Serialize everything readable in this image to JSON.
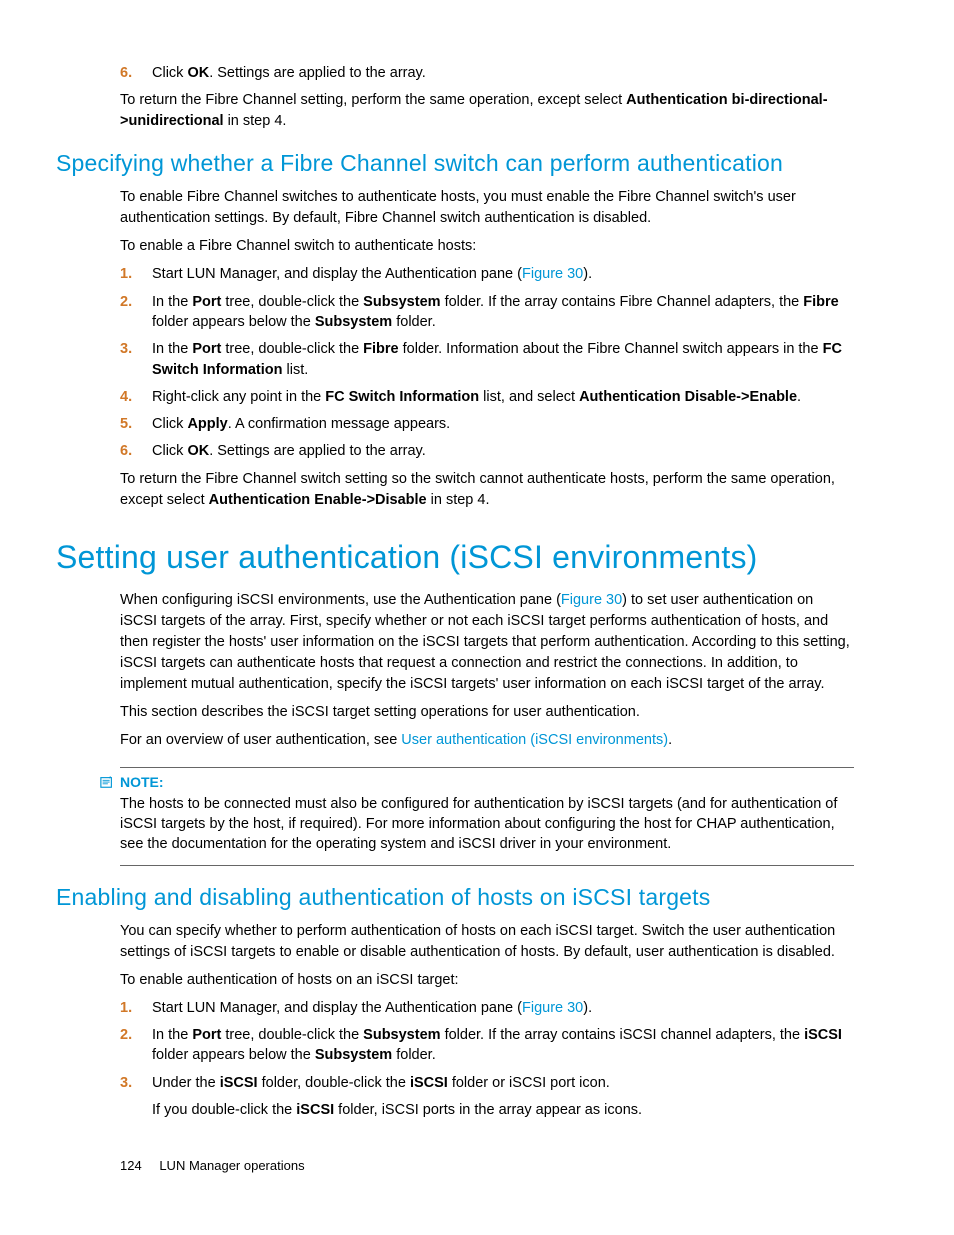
{
  "top_steps": [
    {
      "n": "6.",
      "parts": [
        [
          "Click "
        ],
        [
          "b",
          "OK"
        ],
        [
          ". Settings are applied to the array."
        ]
      ]
    }
  ],
  "top_after": {
    "parts": [
      [
        "To return the Fibre Channel setting, perform the same operation, except select "
      ],
      [
        "b",
        "Authentication bi-directional->unidirectional"
      ],
      [
        " in step 4."
      ]
    ]
  },
  "sec1_title": "Specifying whether a Fibre Channel switch can perform authentication",
  "sec1_intro": "To enable Fibre Channel switches to authenticate hosts, you must enable the Fibre Channel switch's user authentication settings. By default, Fibre Channel switch authentication is disabled.",
  "sec1_lead": "To enable a Fibre Channel switch to authenticate hosts:",
  "sec1_steps": [
    {
      "n": "1.",
      "parts": [
        [
          "Start LUN Manager, and display the Authentication pane ("
        ],
        [
          "l",
          "Figure 30"
        ],
        [
          ")."
        ]
      ]
    },
    {
      "n": "2.",
      "parts": [
        [
          "In the "
        ],
        [
          "b",
          "Port"
        ],
        [
          " tree, double-click the "
        ],
        [
          "b",
          "Subsystem"
        ],
        [
          " folder. If the array contains Fibre Channel adapters, the "
        ],
        [
          "b",
          "Fibre"
        ],
        [
          " folder appears below the "
        ],
        [
          "b",
          "Subsystem"
        ],
        [
          " folder."
        ]
      ]
    },
    {
      "n": "3.",
      "parts": [
        [
          "In the "
        ],
        [
          "b",
          "Port"
        ],
        [
          " tree, double-click the "
        ],
        [
          "b",
          "Fibre"
        ],
        [
          " folder. Information about the Fibre Channel switch appears in the "
        ],
        [
          "b",
          "FC Switch Information"
        ],
        [
          " list."
        ]
      ]
    },
    {
      "n": "4.",
      "parts": [
        [
          "Right-click any point in the "
        ],
        [
          "b",
          "FC Switch Information"
        ],
        [
          " list, and select "
        ],
        [
          "b",
          "Authentication Disable->Enable"
        ],
        [
          "."
        ]
      ]
    },
    {
      "n": "5.",
      "parts": [
        [
          "Click "
        ],
        [
          "b",
          "Apply"
        ],
        [
          ". A confirmation message appears."
        ]
      ]
    },
    {
      "n": "6.",
      "parts": [
        [
          "Click "
        ],
        [
          "b",
          "OK"
        ],
        [
          ". Settings are applied to the array."
        ]
      ]
    }
  ],
  "sec1_after": {
    "parts": [
      [
        "To return the Fibre Channel switch setting so the switch cannot authenticate hosts, perform the same operation, except select "
      ],
      [
        "b",
        "Authentication Enable->Disable"
      ],
      [
        " in step 4."
      ]
    ]
  },
  "big_title": "Setting user authentication (iSCSI environments)",
  "big_p1": {
    "parts": [
      [
        "When configuring iSCSI environments, use the Authentication pane ("
      ],
      [
        "l",
        "Figure 30"
      ],
      [
        ") to set user authentication on iSCSI targets of the array. First, specify whether or not each iSCSI target performs authentication of hosts, and then register the hosts' user information on the iSCSI targets that perform authentication. According to this setting, iSCSI targets can authenticate hosts that request a connection and restrict the connections. In addition, to implement mutual authentication, specify the iSCSI targets' user information on each iSCSI target of the array."
      ]
    ]
  },
  "big_p2": "This section describes the iSCSI target setting operations for user authentication.",
  "big_p3": {
    "parts": [
      [
        "For an overview of user authentication, see "
      ],
      [
        "l",
        "User authentication (iSCSI environments)"
      ],
      [
        "."
      ]
    ]
  },
  "note_label": "NOTE:",
  "note_body": "The hosts to be connected must also be configured for authentication by iSCSI targets (and for authentication of iSCSI targets by the host, if required). For more information about configuring the host for CHAP authentication, see the documentation for the operating system and iSCSI driver in your environment.",
  "sec2_title": "Enabling and disabling authentication of hosts on iSCSI targets",
  "sec2_intro": "You can specify whether to perform authentication of hosts on each iSCSI target. Switch the user authentication settings of iSCSI targets to enable or disable authentication of hosts. By default, user authentication is disabled.",
  "sec2_lead": "To enable authentication of hosts on an iSCSI target:",
  "sec2_steps": [
    {
      "n": "1.",
      "parts": [
        [
          "Start LUN Manager, and display the Authentication pane ("
        ],
        [
          "l",
          "Figure 30"
        ],
        [
          ")."
        ]
      ]
    },
    {
      "n": "2.",
      "parts": [
        [
          "In the "
        ],
        [
          "b",
          "Port"
        ],
        [
          " tree, double-click the "
        ],
        [
          "b",
          "Subsystem"
        ],
        [
          " folder. If the array contains iSCSI channel adapters, the "
        ],
        [
          "b",
          "iSCSI"
        ],
        [
          " folder appears below the "
        ],
        [
          "b",
          "Subsystem"
        ],
        [
          " folder."
        ]
      ]
    },
    {
      "n": "3.",
      "parts": [
        [
          "Under the "
        ],
        [
          "b",
          "iSCSI"
        ],
        [
          " folder, double-click the "
        ],
        [
          "b",
          "iSCSI"
        ],
        [
          " folder or iSCSI port icon."
        ]
      ]
    }
  ],
  "sec2_tail": {
    "parts": [
      [
        "If you double-click the "
      ],
      [
        "b",
        "iSCSI"
      ],
      [
        " folder, iSCSI ports in the array appear as icons."
      ]
    ]
  },
  "footer_page": "124",
  "footer_title": "LUN Manager operations"
}
